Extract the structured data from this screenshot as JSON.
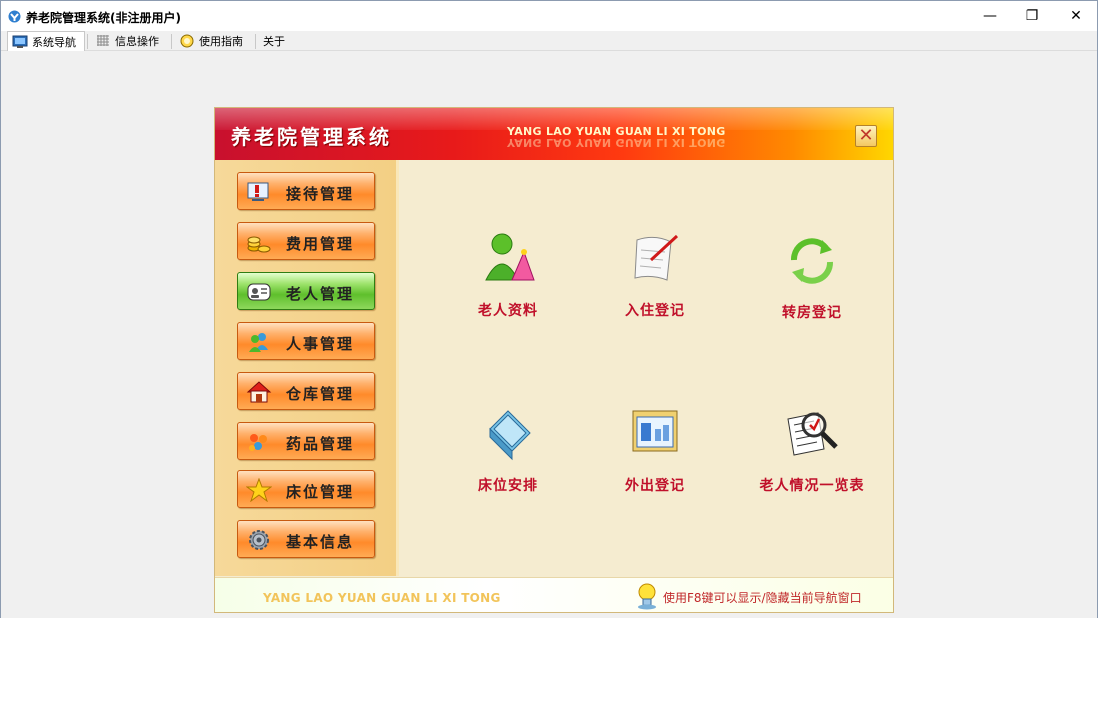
{
  "window": {
    "title": "养老院管理系统(非注册用户)",
    "minimize_symbol": "—",
    "restore_symbol": "❐",
    "close_symbol": "✕"
  },
  "menu": {
    "tabs": [
      {
        "label": "系统导航",
        "icon": "monitor-icon"
      },
      {
        "label": "信息操作",
        "icon": "grid-icon"
      },
      {
        "label": "使用指南",
        "icon": "help-icon"
      },
      {
        "label": "关于",
        "icon": ""
      }
    ]
  },
  "nav_panel": {
    "title": "养老院管理系统",
    "subtitle": "YANG LAO YUAN GUAN LI XI TONG",
    "close_symbol": "✕",
    "sidebar": [
      {
        "label": "接待管理",
        "icon": "reception-icon",
        "active": false
      },
      {
        "label": "费用管理",
        "icon": "coins-icon",
        "active": false
      },
      {
        "label": "老人管理",
        "icon": "elder-card-icon",
        "active": true
      },
      {
        "label": "人事管理",
        "icon": "people-icon",
        "active": false
      },
      {
        "label": "仓库管理",
        "icon": "house-icon",
        "active": false
      },
      {
        "label": "药品管理",
        "icon": "medicine-icon",
        "active": false
      },
      {
        "label": "床位管理",
        "icon": "star-icon",
        "active": false
      },
      {
        "label": "基本信息",
        "icon": "gear-icon",
        "active": false
      }
    ],
    "functions": [
      {
        "label": "老人资料",
        "icon": "person-profile-icon"
      },
      {
        "label": "入住登记",
        "icon": "scroll-pen-icon"
      },
      {
        "label": "转房登记",
        "icon": "recycle-arrows-icon"
      },
      {
        "label": "床位安排",
        "icon": "bed-icon"
      },
      {
        "label": "外出登记",
        "icon": "window-chart-icon"
      },
      {
        "label": "老人情况一览表",
        "icon": "magnifier-list-icon"
      }
    ],
    "footer_text": "YANG LAO YUAN GUAN LI XI TONG",
    "footer_tip": "使用F8键可以显示/隐藏当前导航窗口"
  }
}
